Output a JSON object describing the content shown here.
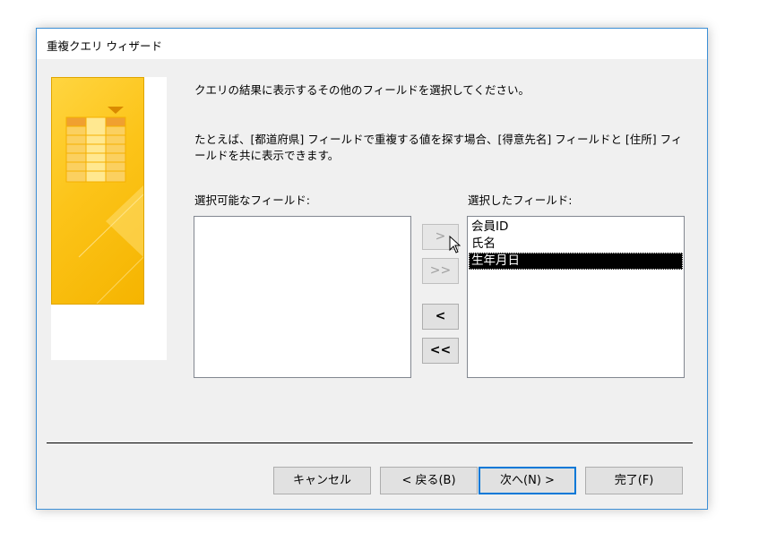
{
  "window": {
    "title": "重複クエリ ウィザード"
  },
  "instructions": {
    "line1": "クエリの結果に表示するその他のフィールドを選択してください。",
    "line2": "たとえば、[都道府県] フィールドで重複する値を探す場合、[得意先名] フィールドと [住所] フィールドを共に表示できます。"
  },
  "available_fields": {
    "label": "選択可能なフィールド:",
    "items": []
  },
  "selected_fields": {
    "label": "選択したフィールド:",
    "items": [
      "会員ID",
      "氏名",
      "生年月日"
    ],
    "selected_index": 2
  },
  "move_buttons": {
    "add": ">",
    "add_all": ">>",
    "remove": "<",
    "remove_all": "<<"
  },
  "footer": {
    "cancel": "キャンセル",
    "back": "< 戻る(B)",
    "next": "次へ(N) >",
    "finish": "完了(F)"
  },
  "colors": {
    "accent": "#0078d7",
    "art_yellow": "#fcc419",
    "selection": "#000000"
  }
}
